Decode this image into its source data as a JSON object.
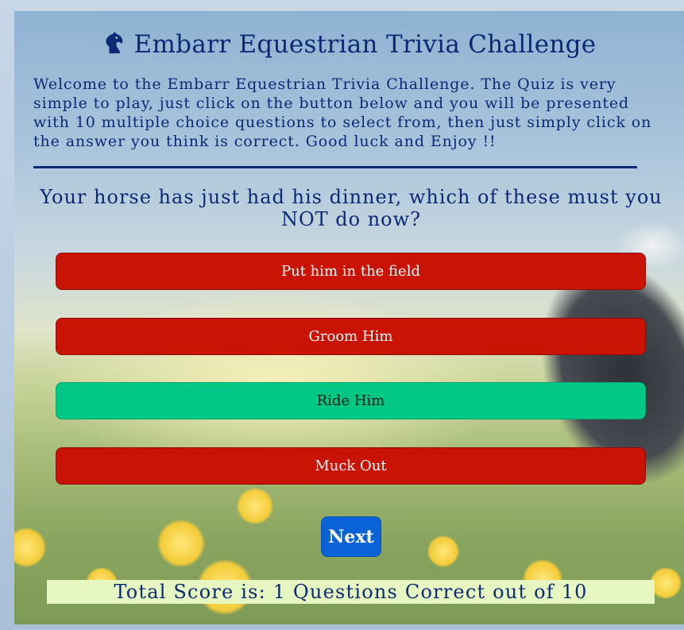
{
  "header": {
    "title": "Embarr Equestrian Trivia Challenge",
    "icon": "horse-head-icon"
  },
  "intro": {
    "text": "Welcome to the Embarr Equestrian Trivia Challenge. The Quiz is very simple to play, just click on the button below and you will be presented with 10 multiple choice questions to select from, then just simply click on the answer you think is correct. Good luck and Enjoy !!"
  },
  "quiz": {
    "question": "Your horse has just had his dinner, which of these must you NOT do now?",
    "answers": [
      {
        "label": "Put him in the field",
        "state": "incorrect"
      },
      {
        "label": "Groom Him",
        "state": "incorrect"
      },
      {
        "label": "Ride Him",
        "state": "correct"
      },
      {
        "label": "Muck Out",
        "state": "incorrect"
      }
    ],
    "next_label": "Next"
  },
  "score": {
    "text": "Total Score is: 1 Questions Correct out of 10"
  },
  "colors": {
    "text_primary": "#0b2a73",
    "incorrect": "#c81305",
    "correct": "#00c784",
    "next_button": "#0a63d6",
    "score_background": "#e7f7c2"
  }
}
